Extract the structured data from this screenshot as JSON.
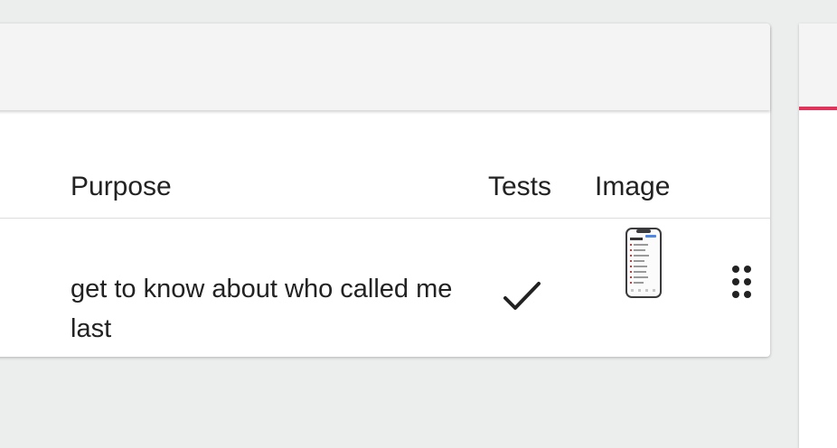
{
  "table": {
    "columns": {
      "purpose": "Purpose",
      "tests": "Tests",
      "image": "Image"
    },
    "rows": [
      {
        "purpose": "get to know about who called me last",
        "tests": "check-icon",
        "image": "phone-screenshot-thumbnail"
      }
    ]
  },
  "icons": {
    "tests_passed": "check-icon",
    "row_menu": "more-dots-icon"
  },
  "colors": {
    "accent": "#e2345a",
    "toolbar": "#f4f4f4",
    "background": "#eceded"
  }
}
